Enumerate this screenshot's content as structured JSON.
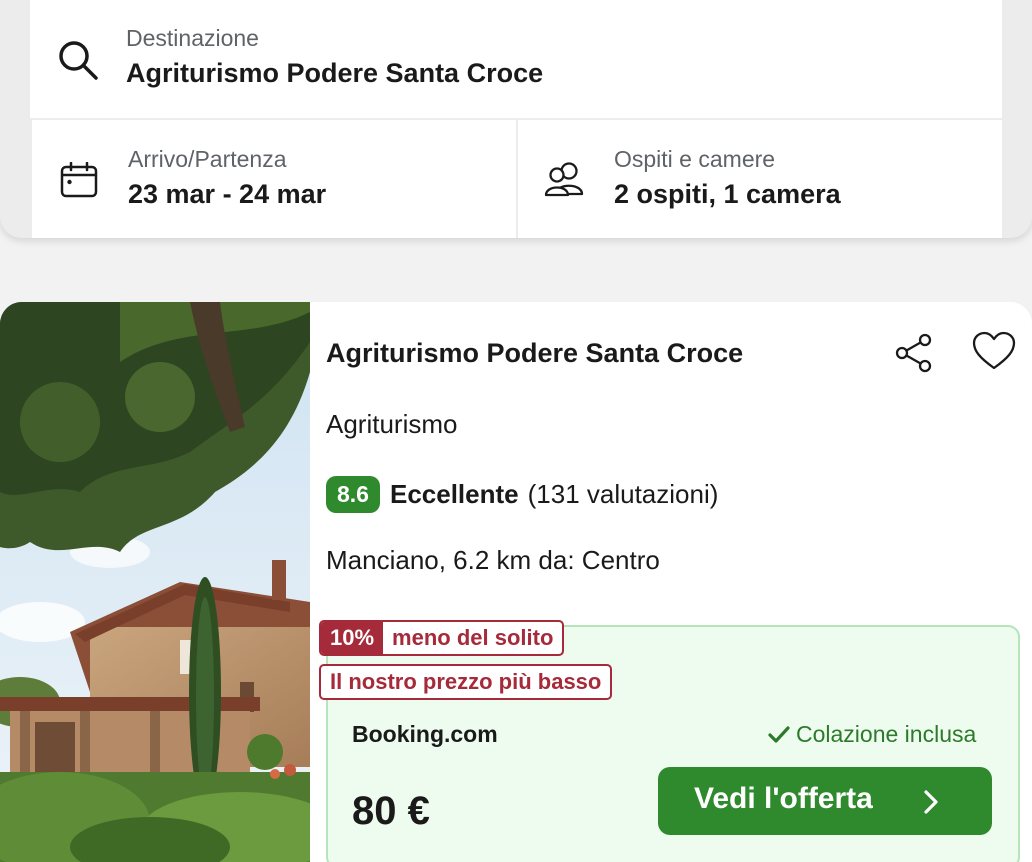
{
  "search": {
    "destination": {
      "label": "Destinazione",
      "value": "Agriturismo Podere Santa Croce",
      "icon": "search-icon"
    },
    "dates": {
      "label": "Arrivo/Partenza",
      "value": "23 mar - 24 mar",
      "icon": "calendar-icon"
    },
    "guests": {
      "label": "Ospiti e camere",
      "value": "2 ospiti, 1 camera",
      "icon": "people-icon"
    }
  },
  "hotel": {
    "name": "Agriturismo Podere Santa Croce",
    "type": "Agriturismo",
    "score": "8.6",
    "rating_word": "Eccellente",
    "rating_count": "(131 valutazioni)",
    "location": "Manciano, 6.2 km da: Centro",
    "deal": {
      "discount_pct": "10%",
      "discount_text": "meno del solito",
      "lowest_price_text": "Il nostro prezzo più basso",
      "provider": "Booking.com",
      "breakfast": "Colazione inclusa",
      "price": "80 €",
      "button_label": "Vedi l'offerta"
    }
  },
  "colors": {
    "accent_green": "#2f8a2d",
    "deal_red": "#a52a3a",
    "deal_bg": "#eefbef"
  }
}
